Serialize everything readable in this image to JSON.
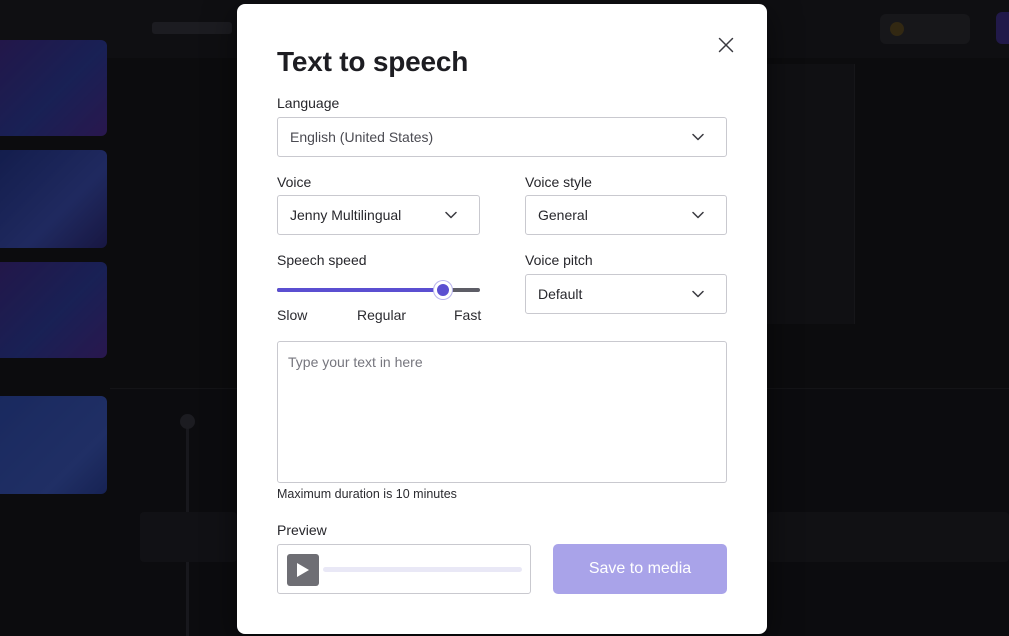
{
  "dialog": {
    "title": "Text to speech",
    "language": {
      "label": "Language",
      "value": "English (United States)"
    },
    "voice": {
      "label": "Voice",
      "value": "Jenny Multilingual"
    },
    "voice_style": {
      "label": "Voice style",
      "value": "General"
    },
    "speech_speed": {
      "label": "Speech speed",
      "level": 0.82,
      "scale_labels": {
        "slow": "Slow",
        "regular": "Regular",
        "fast": "Fast"
      }
    },
    "voice_pitch": {
      "label": "Voice pitch",
      "value": "Default"
    },
    "text_input": {
      "placeholder": "Type your text in here",
      "value": ""
    },
    "duration_hint": "Maximum duration is 10 minutes",
    "preview": {
      "label": "Preview",
      "progress": 0
    },
    "save_button": "Save to media",
    "icons": {
      "close": "close-icon",
      "dropdown": "chevron-down-icon",
      "play": "play-icon"
    }
  },
  "colors": {
    "accent": "#5b4fd1",
    "save_button_disabled": "#a9a3e9",
    "scrim": "#000000"
  }
}
